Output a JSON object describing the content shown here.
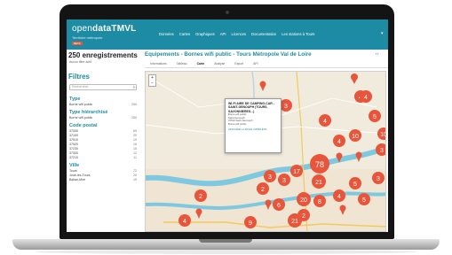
{
  "brand": {
    "logo_open": "open",
    "logo_data": "data",
    "logo_tmvl": "TMVL",
    "subtitle": "Territoire métropole",
    "beta": "BETA"
  },
  "nav": {
    "items": [
      "Données",
      "Cartes",
      "Graphiques",
      "API",
      "Licences",
      "Documentation",
      "Les stations à Tours"
    ]
  },
  "sidebar": {
    "count": "250",
    "count_label": "enregistrements",
    "sub_label": "Aucun filtre actif",
    "filters_title": "Filtres",
    "search_placeholder": "Rechercher...",
    "facets": [
      {
        "title": "Type",
        "items": [
          {
            "label": "Borne wifi public",
            "count": "250"
          }
        ]
      },
      {
        "title": "Type hiérarchisé",
        "items": [
          {
            "label": "Borne wifi public",
            "count": "250"
          }
        ]
      },
      {
        "title": "Code postal",
        "items": [
          {
            "label": "37000",
            "count": "69"
          },
          {
            "label": "37100",
            "count": "20"
          },
          {
            "label": "37510",
            "count": "19"
          },
          {
            "label": "37520",
            "count": "16"
          },
          {
            "label": "37230",
            "count": "15"
          },
          {
            "label": "37300",
            "count": "12"
          },
          {
            "label": "37210",
            "count": "11"
          }
        ]
      },
      {
        "title": "Ville",
        "items": [
          {
            "label": "Tours",
            "count": "72"
          },
          {
            "label": "Joué-lès-Tours",
            "count": "20"
          },
          {
            "label": "Ballan-Miré",
            "count": "19"
          }
        ]
      }
    ]
  },
  "main": {
    "title": "Equipements - Bornes wifi public - Tours Métropole Val de Loire",
    "social": "t  f",
    "tabs": [
      "Informations",
      "Tableau",
      "Carte",
      "Analyse",
      "Export",
      "API"
    ],
    "active_tab": "Carte"
  },
  "map": {
    "zoom_in": "+",
    "zoom_out": "−",
    "popup": {
      "title": "WI-FI AIRE DE CAMPING-CAR - SAINT-GENOUPH (TOURS, SAVONNIERES...)",
      "lines": [
        "Borne wifi public",
        "Saint-Genouph",
        "37510 Saint-Genouph",
        "Borne wifi public"
      ],
      "link": "AFFICHER LA FICHE COMPLÈTE"
    },
    "clusters": [
      "3",
      "4",
      "10",
      "5",
      "3",
      "3",
      "4",
      "78",
      "3",
      "21",
      "17",
      "5",
      "4",
      "5",
      "2",
      "20",
      "2",
      "8",
      "6",
      "2",
      "21",
      "9",
      "4"
    ],
    "colors": {
      "cluster": "#e8553b",
      "water": "#7ec9e0",
      "land": "#f0ebdc",
      "brand": "#1d8ba4"
    }
  }
}
